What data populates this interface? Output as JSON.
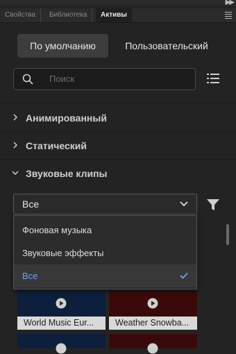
{
  "tabs": [
    {
      "label": "Свойства"
    },
    {
      "label": "Библиотека"
    },
    {
      "label": "Активы"
    }
  ],
  "segmented": {
    "default_label": "По умолчанию",
    "custom_label": "Пользовательский"
  },
  "search": {
    "placeholder": "Поиск"
  },
  "sections": {
    "animated": "Анимированный",
    "static": "Статический",
    "sound": "Звуковые клипы"
  },
  "filter_select": {
    "value": "Все",
    "options": [
      "Фоновая музыка",
      "Звуковые эффекты",
      "Все"
    ],
    "selected_index": 2
  },
  "clips": [
    {
      "name": "World Music Eur...",
      "color": "#0d1f3c"
    },
    {
      "name": "Weather Snowba...",
      "color": "#3a0a0a"
    },
    {
      "name": "",
      "color": "#0d1f3c"
    },
    {
      "name": "",
      "color": "#3a0a0a"
    }
  ],
  "colors": {
    "accent": "#6ea0f4",
    "panel": "#232323"
  }
}
